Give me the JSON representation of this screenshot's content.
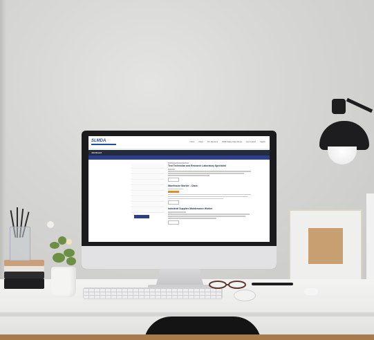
{
  "scene": {
    "description_tag": "desk-workspace-photo"
  },
  "screen": {
    "logo_text": "SLMDA",
    "nav": [
      "Home",
      "About",
      "Our Members",
      "FREE Safety Data Sheets",
      "Get Involved",
      "Search"
    ],
    "page_title": "Job Board",
    "banner_text": "Job Board",
    "jobs": [
      {
        "title": "Test Technician and Research Laboratory Specialist"
      },
      {
        "title": "Warehouse Worker - Class"
      },
      {
        "title": "Industrial Supplies Maintenance Worker"
      }
    ]
  }
}
